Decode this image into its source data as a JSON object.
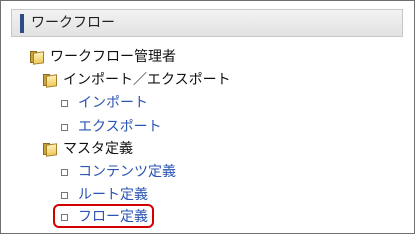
{
  "panel": {
    "title": "ワークフロー"
  },
  "tree": {
    "root": {
      "label": "ワークフロー管理者",
      "icon": "folder-icon"
    },
    "group_import_export": {
      "label": "インポート／エクスポート",
      "icon": "folder-icon",
      "items": [
        "インポート",
        "エクスポート"
      ]
    },
    "group_master": {
      "label": "マスタ定義",
      "icon": "folder-icon",
      "items": [
        "コンテンツ定義",
        "ルート定義",
        "フロー定義"
      ]
    }
  },
  "colors": {
    "link": "#2b54b4",
    "accent_bar": "#2f4a86",
    "highlight_border": "#d10000"
  }
}
